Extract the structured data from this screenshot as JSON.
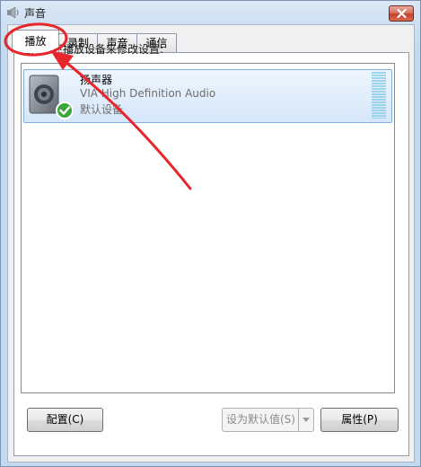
{
  "window": {
    "title": "声音"
  },
  "tabs": [
    {
      "label": "播放"
    },
    {
      "label": "录制"
    },
    {
      "label": "声音"
    },
    {
      "label": "通信"
    }
  ],
  "instruction": "选择以下播放设备来修改设置:",
  "devices": [
    {
      "name": "扬声器",
      "description": "VIA High Definition Audio",
      "status": "默认设备",
      "icon": "speaker-icon",
      "badge": "check-badge-icon"
    }
  ],
  "buttons": {
    "configure": "配置(C)",
    "set_default": "设为默认值(S)",
    "properties": "属性(P)"
  },
  "colors": {
    "annotation": "#e8252c",
    "selection": "#d6e7fa",
    "close": "#c2422d"
  }
}
